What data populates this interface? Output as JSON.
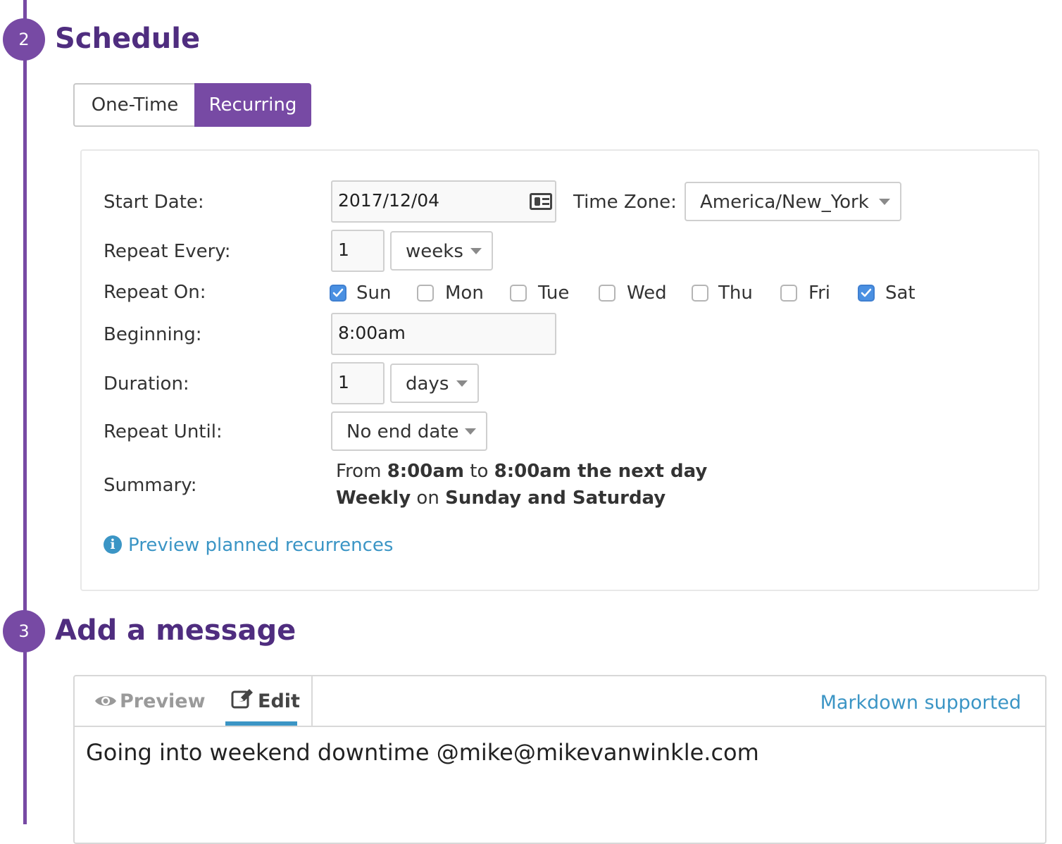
{
  "schedule": {
    "step_number": "2",
    "title": "Schedule",
    "toggle": {
      "one_time_label": "One-Time",
      "recurring_label": "Recurring",
      "selected": "Recurring"
    },
    "form": {
      "start_date_label": "Start Date:",
      "start_date_value": "2017/12/04",
      "time_zone_label": "Time Zone:",
      "time_zone_value": "America/New_York",
      "repeat_every_label": "Repeat Every:",
      "repeat_every_value": "1",
      "repeat_every_unit": "weeks",
      "repeat_on_label": "Repeat On:",
      "days": [
        {
          "label": "Sun",
          "checked": true
        },
        {
          "label": "Mon",
          "checked": false
        },
        {
          "label": "Tue",
          "checked": false
        },
        {
          "label": "Wed",
          "checked": false
        },
        {
          "label": "Thu",
          "checked": false
        },
        {
          "label": "Fri",
          "checked": false
        },
        {
          "label": "Sat",
          "checked": true
        }
      ],
      "beginning_label": "Beginning:",
      "beginning_value": "8:00am",
      "duration_label": "Duration:",
      "duration_value": "1",
      "duration_unit": "days",
      "repeat_until_label": "Repeat Until:",
      "repeat_until_value": "No end date",
      "summary_label": "Summary:",
      "summary": {
        "line1": {
          "prefix": "From ",
          "start": "8:00am",
          "mid": " to ",
          "end": "8:00am the next day"
        },
        "line2": {
          "freq": "Weekly",
          "mid": " on ",
          "days": "Sunday and Saturday"
        }
      },
      "preview_link": "Preview planned recurrences"
    }
  },
  "message": {
    "step_number": "3",
    "title": "Add a message",
    "tabs": {
      "preview_label": "Preview",
      "edit_label": "Edit",
      "active": "Edit"
    },
    "markdown_note": "Markdown supported",
    "text": "Going into weekend downtime @mike@mikevanwinkle.com"
  },
  "colors": {
    "accent": "#774aa4",
    "title": "#4f2d7f",
    "link": "#3b95c5",
    "checkbox": "#4a90e2"
  }
}
